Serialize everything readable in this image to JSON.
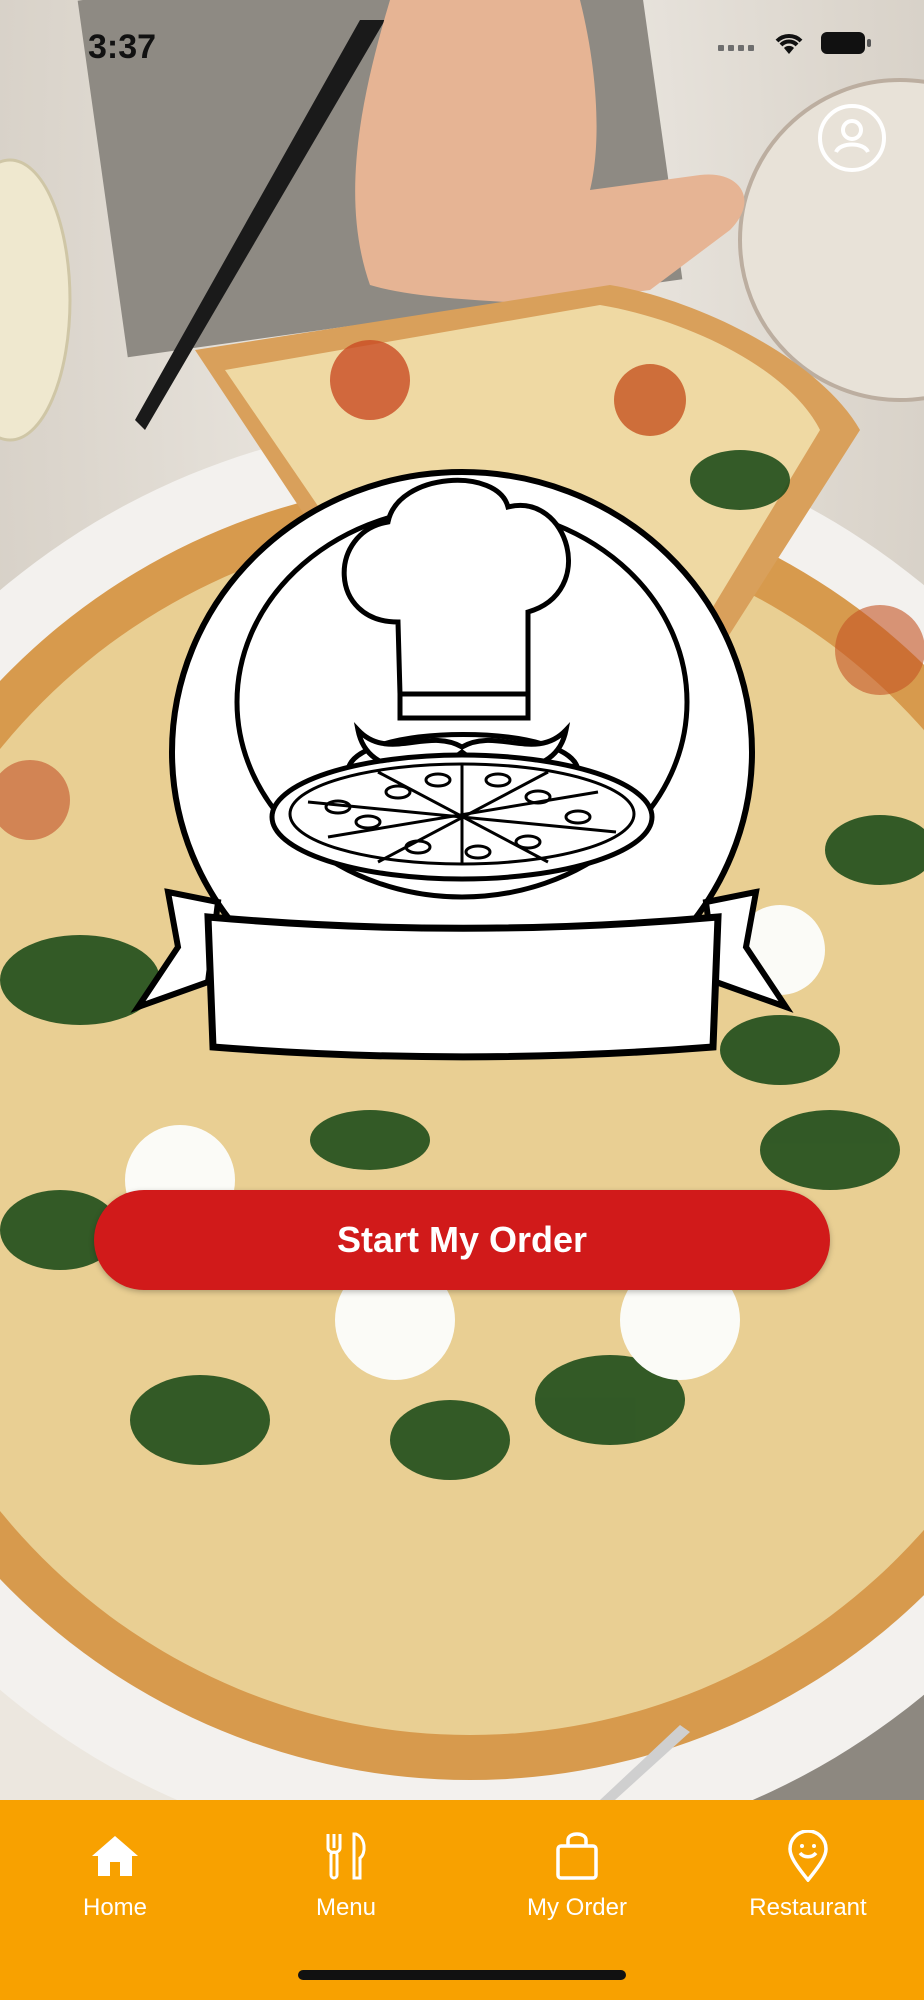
{
  "status": {
    "time": "3:37"
  },
  "header": {
    "profile_icon": "user-circle-icon"
  },
  "main": {
    "logo_icon": "chef-pizza-logo",
    "cta_label": "Start My Order"
  },
  "tabbar": {
    "items": [
      {
        "label": "Home",
        "icon": "home-icon"
      },
      {
        "label": "Menu",
        "icon": "fork-knife-icon"
      },
      {
        "label": "My Order",
        "icon": "shopping-bag-icon"
      },
      {
        "label": "Restaurant",
        "icon": "location-pin-icon"
      }
    ]
  },
  "colors": {
    "tabbar_bg": "#f8a100",
    "cta_bg": "#d11a1a",
    "cta_text": "#ffffff"
  }
}
